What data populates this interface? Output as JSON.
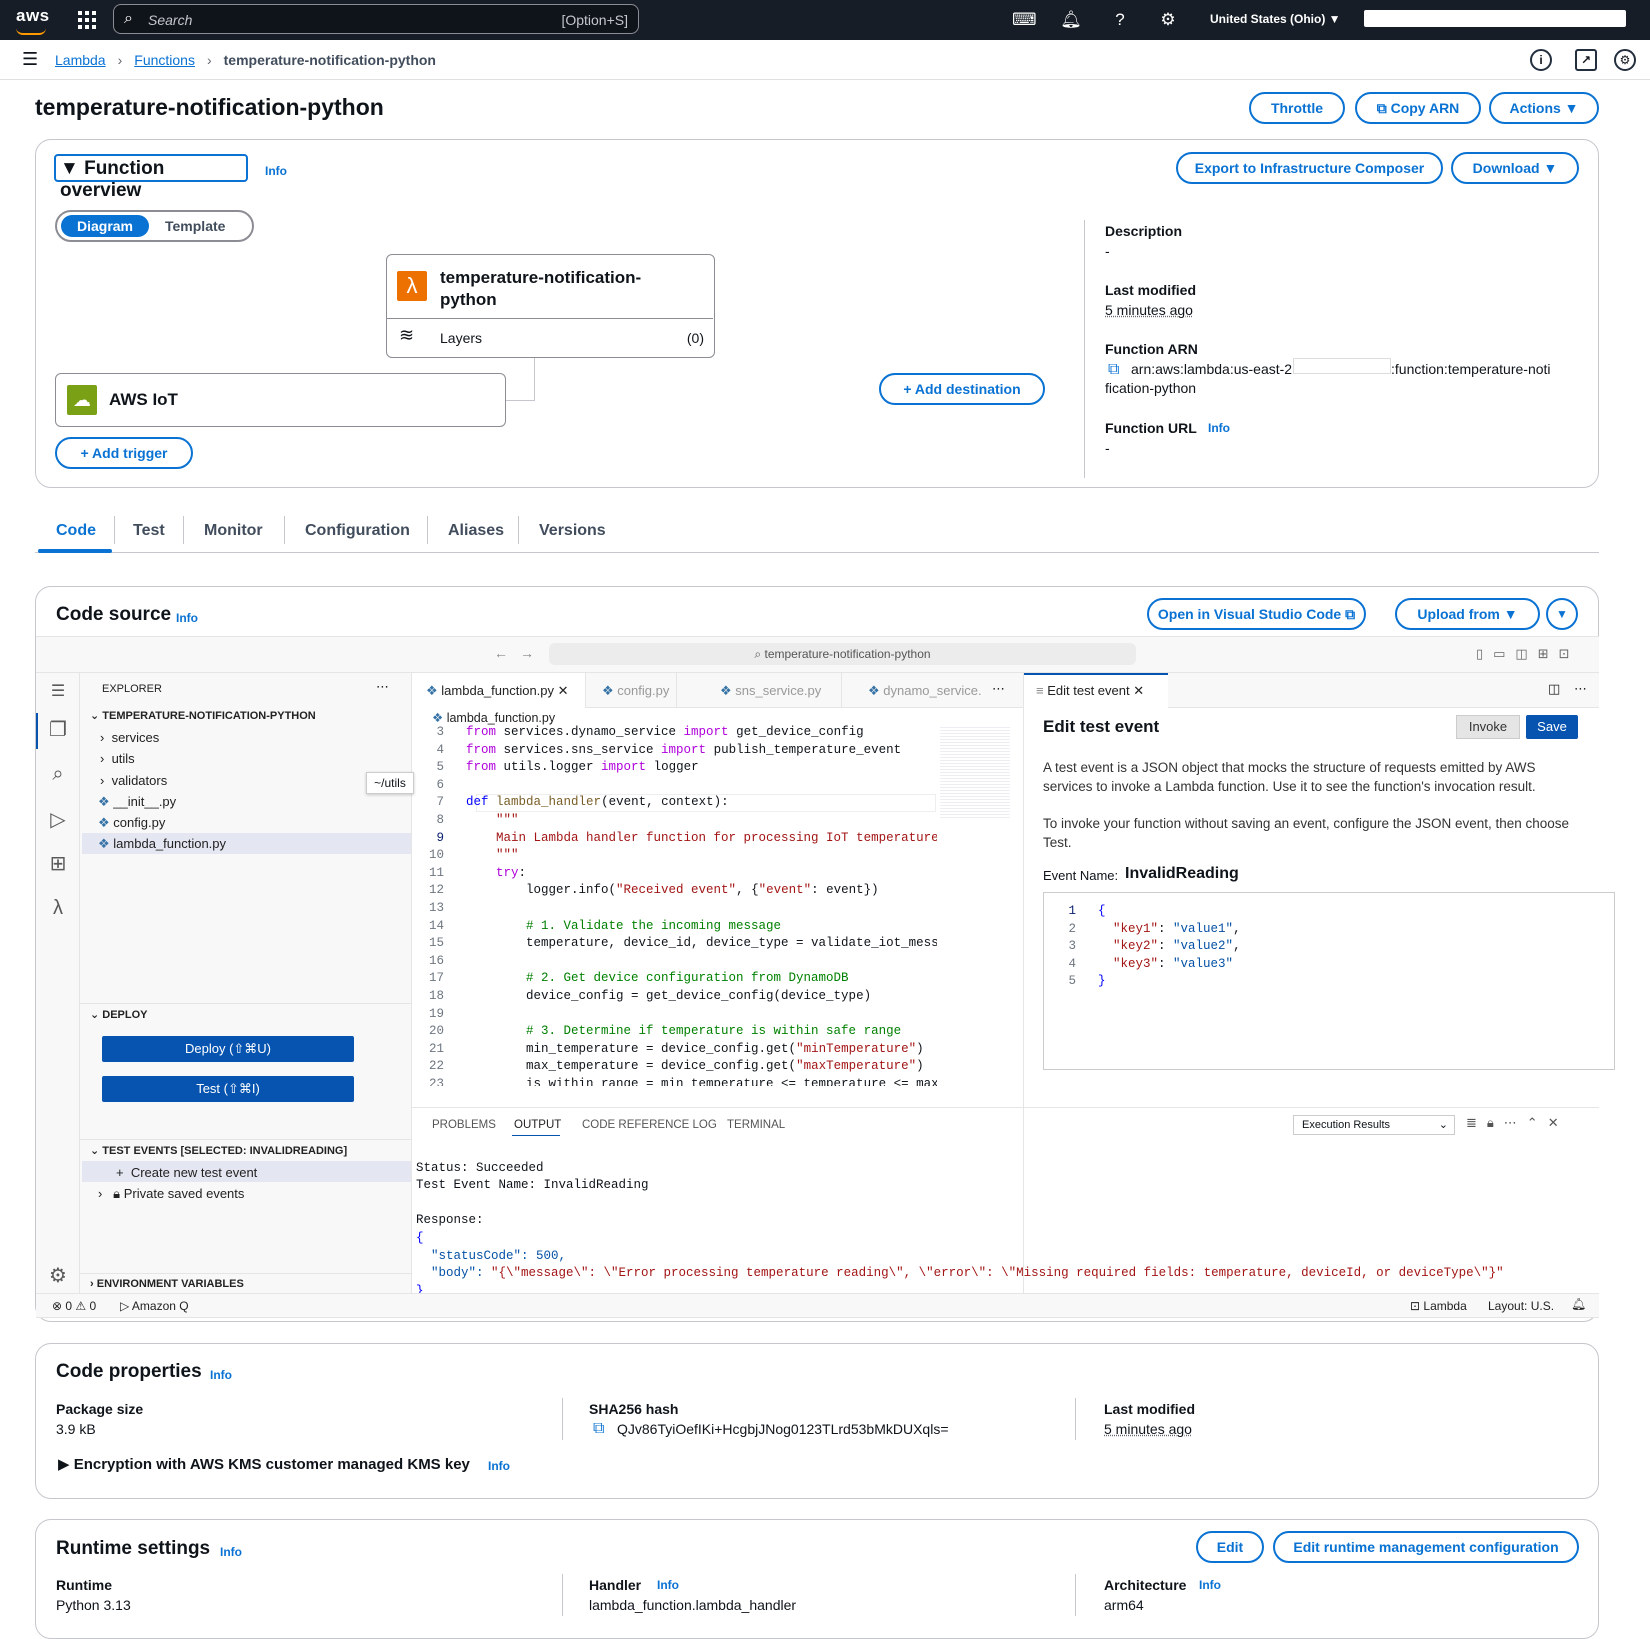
{
  "topbar": {
    "logo": "aws",
    "search_placeholder": "Search",
    "search_shortcut": "[Option+S]",
    "region": "United States (Ohio) ▼"
  },
  "breadcrumb": {
    "items": [
      "Lambda",
      "Functions"
    ],
    "current": "temperature-notification-python"
  },
  "page_title": "temperature-notification-python",
  "header_buttons": {
    "throttle": "Throttle",
    "copy_arn": "Copy ARN",
    "actions": "Actions ▼"
  },
  "overview": {
    "title": "Function overview",
    "info": "Info",
    "export": "Export to Infrastructure Composer",
    "download": "Download ▼",
    "seg_on": "Diagram",
    "seg_off": "Template",
    "function_name_line1": "temperature-notification-",
    "function_name_line2": "python",
    "layers": "Layers",
    "layers_count": "(0)",
    "trigger": "AWS IoT",
    "add_trigger": "Add trigger",
    "add_destination": "Add destination",
    "description_label": "Description",
    "description": "-",
    "last_modified_label": "Last modified",
    "last_modified": "5 minutes ago",
    "arn_label": "Function ARN",
    "arn_prefix": "arn:aws:lambda:us-east-2:",
    "arn_suffix": ":function:temperature-noti",
    "arn_line2": "fication-python",
    "url_label": "Function URL",
    "url_info": "Info",
    "url": "-"
  },
  "tabs": [
    "Code",
    "Test",
    "Monitor",
    "Configuration",
    "Aliases",
    "Versions"
  ],
  "code_source": {
    "title": "Code source",
    "info": "Info",
    "open_vscode": "Open in Visual Studio Code",
    "upload_from": "Upload from ▼",
    "ide_search": "temperature-notification-python",
    "explorer_label": "EXPLORER",
    "project": "TEMPERATURE-NOTIFICATION-PYTHON",
    "tree": [
      "services",
      "utils",
      "validators",
      "__init__.py",
      "config.py",
      "lambda_function.py"
    ],
    "tooltip": "~/utils",
    "deploy_section": "DEPLOY",
    "deploy_btn": "Deploy (⇧⌘U)",
    "test_btn": "Test (⇧⌘I)",
    "test_events_section": "TEST EVENTS [SELECTED: INVALIDREADING]",
    "create_event": "Create new test event",
    "private_events": "Private saved events",
    "env_vars": "ENVIRONMENT VARIABLES",
    "editor_tabs": [
      "lambda_function.py",
      "config.py",
      "sns_service.py",
      "dynamo_service.",
      "Edit test event"
    ],
    "file_breadcrumb": "lambda_function.py",
    "code_lines": [
      {
        "n": "3",
        "t": "from services.dynamo_service import get_device_config"
      },
      {
        "n": "4",
        "t": "from services.sns_service import publish_temperature_event"
      },
      {
        "n": "5",
        "t": "from utils.logger import logger"
      },
      {
        "n": "6",
        "t": ""
      },
      {
        "n": "7",
        "t": "def lambda_handler(event, context):"
      },
      {
        "n": "8",
        "t": "    \"\"\""
      },
      {
        "n": "9",
        "t": "    Main Lambda handler function for processing IoT temperature r"
      },
      {
        "n": "10",
        "t": "    \"\"\""
      },
      {
        "n": "11",
        "t": "    try:"
      },
      {
        "n": "12",
        "t": "        logger.info(\"Received event\", {\"event\": event})"
      },
      {
        "n": "13",
        "t": ""
      },
      {
        "n": "14",
        "t": "        # 1. Validate the incoming message"
      },
      {
        "n": "15",
        "t": "        temperature, device_id, device_type = validate_iot_messag"
      },
      {
        "n": "16",
        "t": ""
      },
      {
        "n": "17",
        "t": "        # 2. Get device configuration from DynamoDB"
      },
      {
        "n": "18",
        "t": "        device_config = get_device_config(device_type)"
      },
      {
        "n": "19",
        "t": ""
      },
      {
        "n": "20",
        "t": "        # 3. Determine if temperature is within safe range"
      },
      {
        "n": "21",
        "t": "        min_temperature = device_config.get(\"minTemperature\")"
      },
      {
        "n": "22",
        "t": "        max_temperature = device_config.get(\"maxTemperature\")"
      },
      {
        "n": "23",
        "t": "        is_within_range = min_temperature <= temperature <= max_t"
      },
      {
        "n": "24",
        "t": ""
      }
    ],
    "test_event": {
      "title": "Edit test event",
      "invoke": "Invoke",
      "save": "Save",
      "p1": "A test event is a JSON object that mocks the structure of requests emitted by AWS services to invoke a Lambda function. Use it to see the function's invocation result.",
      "p2": "To invoke your function without saving an event, configure the JSON event, then choose Test.",
      "event_name_label": "Event Name:",
      "event_name": "InvalidReading",
      "json": [
        {
          "n": "1",
          "t": "{"
        },
        {
          "n": "2",
          "t": "  \"key1\": \"value1\","
        },
        {
          "n": "3",
          "t": "  \"key2\": \"value2\","
        },
        {
          "n": "4",
          "t": "  \"key3\": \"value3\""
        },
        {
          "n": "5",
          "t": "}"
        }
      ]
    },
    "panel_tabs": [
      "PROBLEMS",
      "OUTPUT",
      "CODE REFERENCE LOG",
      "TERMINAL"
    ],
    "output_select": "Execution Results",
    "output": {
      "status": "Status: Succeeded",
      "event_name": "Test Event Name: InvalidReading",
      "response": "Response:",
      "open": "{",
      "status_code": "  \"statusCode\": 500,",
      "body_key": "  \"body\": ",
      "body_val": "\"{\\\"message\\\": \\\"Error processing temperature reading\\\", \\\"error\\\": \\\"Missing required fields: temperature, deviceId, or deviceType\\\"}\"",
      "close": "}"
    },
    "statusbar": {
      "errors": "⊗ 0 ⚠ 0",
      "amazon_q": "▷ Amazon Q",
      "lambda": "Lambda",
      "layout": "Layout: U.S."
    }
  },
  "code_properties": {
    "title": "Code properties",
    "info": "Info",
    "pkg_label": "Package size",
    "pkg": "3.9 kB",
    "sha_label": "SHA256 hash",
    "sha": "QJv86TyiOefIKi+HcgbjJNog0123TLrd53bMkDUXqls=",
    "lm_label": "Last modified",
    "lm": "5 minutes ago",
    "encryption": "Encryption with AWS KMS customer managed KMS key",
    "enc_info": "Info"
  },
  "runtime": {
    "title": "Runtime settings",
    "info": "Info",
    "edit": "Edit",
    "edit_mgmt": "Edit runtime management configuration",
    "runtime_label": "Runtime",
    "runtime": "Python 3.13",
    "handler_label": "Handler",
    "handler_info": "Info",
    "handler": "lambda_function.lambda_handler",
    "arch_label": "Architecture",
    "arch_info": "Info",
    "arch": "arm64"
  }
}
